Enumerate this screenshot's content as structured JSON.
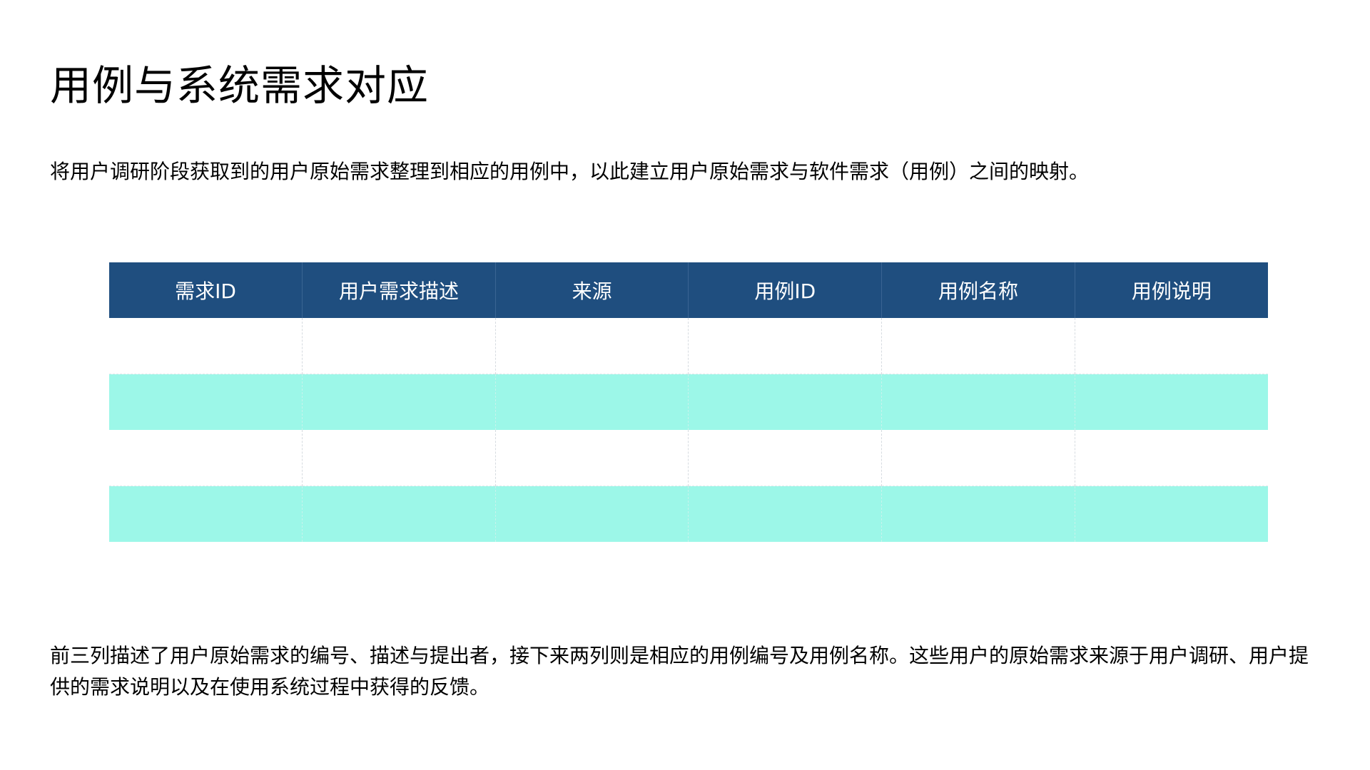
{
  "page": {
    "title": "用例与系统需求对应",
    "intro": "将用户调研阶段获取到的用户原始需求整理到相应的用例中，以此建立用户原始需求与软件需求（用例）之间的映射。",
    "footer_note": "前三列描述了用户原始需求的编号、描述与提出者，接下来两列则是相应的用例编号及用例名称。这些用户的原始需求来源于用户调研、用户提供的需求说明以及在使用系统过程中获得的反馈。"
  },
  "table": {
    "headers": [
      "需求ID",
      "用户需求描述",
      "来源",
      "用例ID",
      "用例名称",
      "用例说明"
    ],
    "rows": [
      [
        "",
        "",
        "",
        "",
        "",
        ""
      ],
      [
        "",
        "",
        "",
        "",
        "",
        ""
      ],
      [
        "",
        "",
        "",
        "",
        "",
        ""
      ],
      [
        "",
        "",
        "",
        "",
        "",
        ""
      ]
    ]
  },
  "colors": {
    "header_bg": "#1f4e7f",
    "header_text": "#ffffff",
    "row_alt_bg": "#9cf7e8",
    "row_bg": "#ffffff"
  }
}
